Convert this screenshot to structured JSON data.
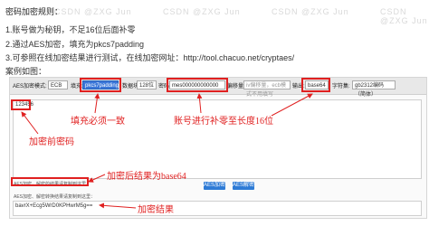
{
  "watermark": "CSDN @ZXG Jun",
  "rules": {
    "title": "密码加密规则：",
    "items": [
      "1.账号做为秘钥，不足16位后面补零",
      "2.通过AES加密，填充为pkcs7padding",
      "3.可参照在线加密结果进行测试，在线加密网址：http://tool.chacuo.net/cryptaes/",
      "案例如图："
    ]
  },
  "toolbar": {
    "mode_label": "AES加密模式:",
    "mode_value": "ECB",
    "padding_label": "填充:",
    "padding_value": "pkcs7padding",
    "length_label": "数据块:",
    "length_value": "128位",
    "key_label": "密码:",
    "key_value": "mes000000000000",
    "iv_label": "偏移量:",
    "iv_placeholder": "iv偏移量，ecb模式不用填写",
    "output_label": "输出:",
    "output_value": "base64",
    "charset_label": "字符集:",
    "charset_value": "gb2312编码（简体）"
  },
  "input_text": "123456",
  "hint_text": "AES加密，解密的结果请复制到这里",
  "buttons": {
    "encrypt": "AES加密",
    "decrypt": "AES解密"
  },
  "result_label": "AES加密、解密转换结果请复制到这里：",
  "result_text": "bavrX+Ecg5WrD0KPHwrM5g==",
  "annotations": {
    "fill": "填充必须一致",
    "account": "账号进行补零至长度16位",
    "before": "加密前密码",
    "base64": "加密后结果为base64",
    "result": "加密结果"
  },
  "colors": {
    "accent": "#e02020",
    "button": "#2e7bd6"
  }
}
